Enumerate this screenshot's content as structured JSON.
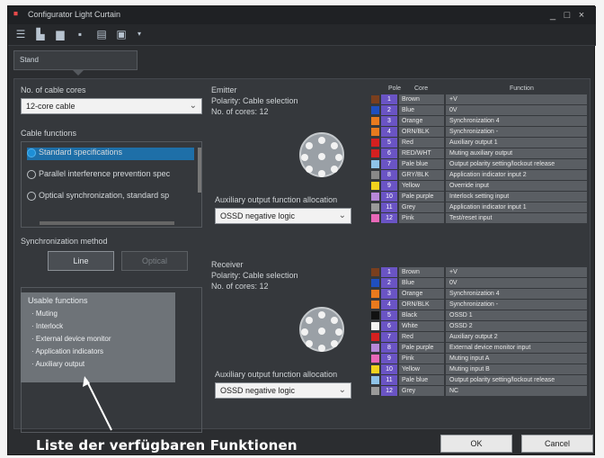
{
  "window": {
    "title": "Configurator Light Curtain",
    "minimize": "_",
    "maximize": "□",
    "close": "×"
  },
  "toolbar": {
    "icons": [
      "menu-icon",
      "new-file-icon",
      "open-folder-icon",
      "save-icon",
      "connect-icon",
      "device-icon",
      "dropdown-icon"
    ]
  },
  "tab": {
    "label": "Stand"
  },
  "left": {
    "cores_label": "No. of cable cores",
    "cores_value": "12-core cable",
    "cable_functions_label": "Cable functions",
    "cable_functions": [
      {
        "label": "Standard specifications",
        "selected": true
      },
      {
        "label": "Parallel interference prevention spec",
        "selected": false
      },
      {
        "label": "Optical synchronization, standard sp",
        "selected": false
      }
    ],
    "sync_label": "Synchronization method",
    "sync_line": "Line",
    "sync_optical": "Optical",
    "usable_functions_title": "Usable functions",
    "usable_functions": [
      "Muting",
      "Interlock",
      "External device monitor",
      "Application indicators",
      "Auxiliary output"
    ]
  },
  "emitter": {
    "title": "Emitter",
    "polarity": "Polarity: Cable selection",
    "cores": "No. of cores: 12",
    "aux_label": "Auxiliary output function allocation",
    "aux_value": "OSSD negative logic"
  },
  "receiver": {
    "title": "Receiver",
    "polarity": "Polarity: Cable selection",
    "cores": "No. of cores: 12",
    "aux_label": "Auxiliary output function allocation",
    "aux_value": "OSSD negative logic"
  },
  "table_headers": {
    "pole": "Pole",
    "core": "Core",
    "function": "Function"
  },
  "emitter_rows": [
    {
      "no": "1",
      "core": "Brown",
      "fn": "+V",
      "color": "#7a3f1e"
    },
    {
      "no": "2",
      "core": "Blue",
      "fn": "0V",
      "color": "#1f4fbf"
    },
    {
      "no": "3",
      "core": "Orange",
      "fn": "Synchronization 4",
      "color": "#e87a1e"
    },
    {
      "no": "4",
      "core": "ORN/BLK",
      "fn": "Synchronization -",
      "color": "#e87a1e"
    },
    {
      "no": "5",
      "core": "Red",
      "fn": "Auxiliary output 1",
      "color": "#d42020"
    },
    {
      "no": "6",
      "core": "RED/WHT",
      "fn": "Muting auxiliary output",
      "color": "#d42020"
    },
    {
      "no": "7",
      "core": "Pale blue",
      "fn": "Output polarity setting/lockout release",
      "color": "#8fc3e8"
    },
    {
      "no": "8",
      "core": "GRY/BLK",
      "fn": "Application indicator input 2",
      "color": "#888888"
    },
    {
      "no": "9",
      "core": "Yellow",
      "fn": "Override input",
      "color": "#f2d21e"
    },
    {
      "no": "10",
      "core": "Pale purple",
      "fn": "Interlock setting input",
      "color": "#b788d8"
    },
    {
      "no": "11",
      "core": "Grey",
      "fn": "Application indicator input 1",
      "color": "#9a9a9a"
    },
    {
      "no": "12",
      "core": "Pink",
      "fn": "Test/reset input",
      "color": "#e868b8"
    }
  ],
  "receiver_rows": [
    {
      "no": "1",
      "core": "Brown",
      "fn": "+V",
      "color": "#7a3f1e"
    },
    {
      "no": "2",
      "core": "Blue",
      "fn": "0V",
      "color": "#1f4fbf"
    },
    {
      "no": "3",
      "core": "Orange",
      "fn": "Synchronization 4",
      "color": "#e87a1e"
    },
    {
      "no": "4",
      "core": "ORN/BLK",
      "fn": "Synchronization -",
      "color": "#e87a1e"
    },
    {
      "no": "5",
      "core": "Black",
      "fn": "OSSD 1",
      "color": "#111111"
    },
    {
      "no": "6",
      "core": "White",
      "fn": "OSSD 2",
      "color": "#f2f2f2"
    },
    {
      "no": "7",
      "core": "Red",
      "fn": "Auxiliary output 2",
      "color": "#d42020"
    },
    {
      "no": "8",
      "core": "Pale purple",
      "fn": "External device monitor input",
      "color": "#b788d8"
    },
    {
      "no": "9",
      "core": "Pink",
      "fn": "Muting input A",
      "color": "#e868b8"
    },
    {
      "no": "10",
      "core": "Yellow",
      "fn": "Muting input B",
      "color": "#f2d21e"
    },
    {
      "no": "11",
      "core": "Pale blue",
      "fn": "Output polarity setting/lockout release",
      "color": "#8fc3e8"
    },
    {
      "no": "12",
      "core": "Grey",
      "fn": "NC",
      "color": "#9a9a9a"
    }
  ],
  "footer": {
    "ok": "OK",
    "cancel": "Cancel"
  },
  "annotation": "Liste der verfügbaren Funktionen"
}
